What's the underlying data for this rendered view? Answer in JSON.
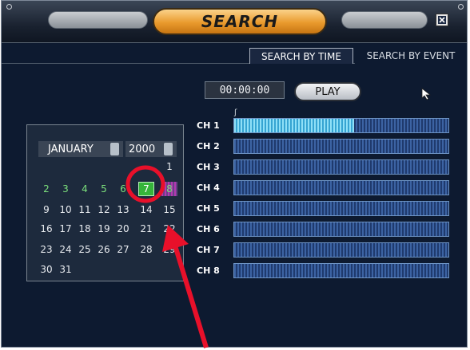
{
  "window": {
    "title": "SEARCH"
  },
  "tabs": {
    "active": "SEARCH BY TIME",
    "inactive": "SEARCH BY EVENT"
  },
  "search_time": {
    "value": "00:00:00"
  },
  "controls": {
    "play_label": "PLAY"
  },
  "calendar": {
    "month": "JANUARY",
    "year": "2000",
    "weeks": [
      [
        "",
        "",
        "",
        "",
        "",
        "",
        "1"
      ],
      [
        "2",
        "3",
        "4",
        "5",
        "6",
        "7",
        "8"
      ],
      [
        "9",
        "10",
        "11",
        "12",
        "13",
        "14",
        "15"
      ],
      [
        "16",
        "17",
        "18",
        "19",
        "20",
        "21",
        "22"
      ],
      [
        "23",
        "24",
        "25",
        "26",
        "27",
        "28",
        "29"
      ],
      [
        "30",
        "31",
        "",
        "",
        "",
        "",
        ""
      ]
    ],
    "selected_day": "7"
  },
  "channels": [
    {
      "label": "CH 1",
      "recorded_fraction": 0.56
    },
    {
      "label": "CH 2",
      "recorded_fraction": 0
    },
    {
      "label": "CH 3",
      "recorded_fraction": 0
    },
    {
      "label": "CH 4",
      "recorded_fraction": 0
    },
    {
      "label": "CH 5",
      "recorded_fraction": 0
    },
    {
      "label": "CH 6",
      "recorded_fraction": 0
    },
    {
      "label": "CH 7",
      "recorded_fraction": 0
    },
    {
      "label": "CH 8",
      "recorded_fraction": 0
    }
  ],
  "colors": {
    "accent": "#e99a2d",
    "highlight_circle": "#e8102a",
    "arrow": "#e8102a",
    "recorded": "#8fe0f7"
  },
  "icons": {
    "close": "close-icon",
    "cursor": "mouse-pointer-icon",
    "arrow": "red-arrow-annotation"
  }
}
